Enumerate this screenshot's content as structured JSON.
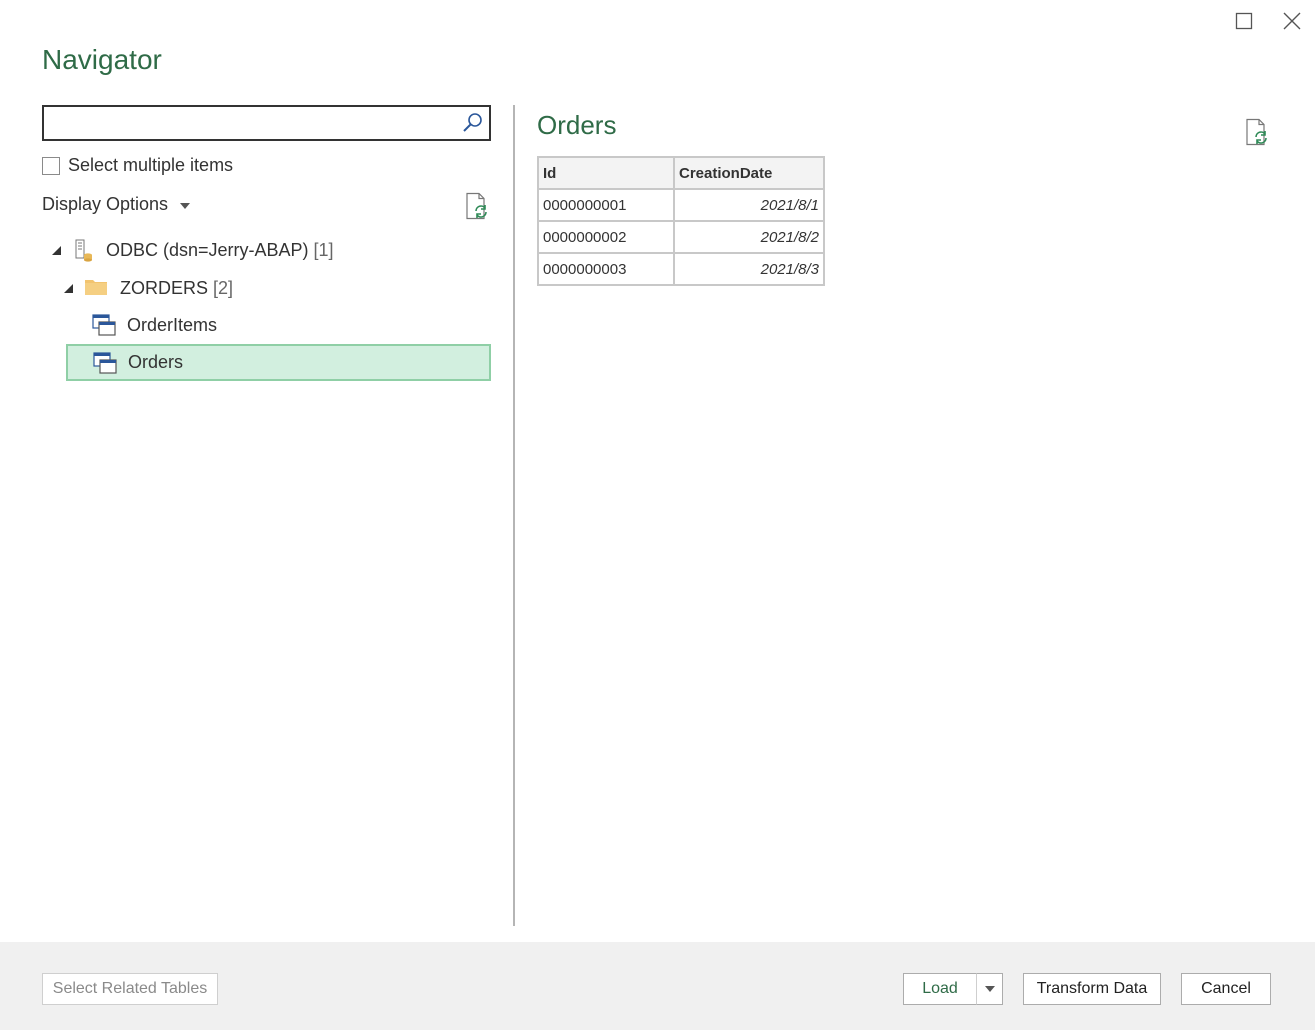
{
  "window": {
    "title": "Navigator",
    "controls": [
      "maximize-icon",
      "close-icon"
    ]
  },
  "left_pane": {
    "search": {
      "value": "",
      "placeholder": ""
    },
    "select_multiple_label": "Select multiple items",
    "select_multiple_checked": false,
    "display_options_label": "Display Options",
    "tree": [
      {
        "label": "ODBC (dsn=Jerry-ABAP)",
        "count": "[1]",
        "icon": "odbc-source-icon",
        "expanded": true
      },
      {
        "label": "ZORDERS",
        "count": "[2]",
        "icon": "folder-icon",
        "expanded": true
      },
      {
        "label": "OrderItems",
        "icon": "table-icon",
        "selected": false
      },
      {
        "label": "Orders",
        "icon": "table-icon",
        "selected": true
      }
    ]
  },
  "preview": {
    "title": "Orders",
    "columns": [
      "Id",
      "CreationDate"
    ],
    "rows": [
      [
        "0000000001",
        "2021/8/1"
      ],
      [
        "0000000002",
        "2021/8/2"
      ],
      [
        "0000000003",
        "2021/8/3"
      ]
    ]
  },
  "footer": {
    "select_related_label": "Select Related Tables",
    "load_label": "Load",
    "transform_label": "Transform Data",
    "cancel_label": "Cancel"
  },
  "colors": {
    "accent_green": "#2f6b47",
    "selection_fill": "#d2efdf",
    "selection_border": "#8fcfa6"
  }
}
